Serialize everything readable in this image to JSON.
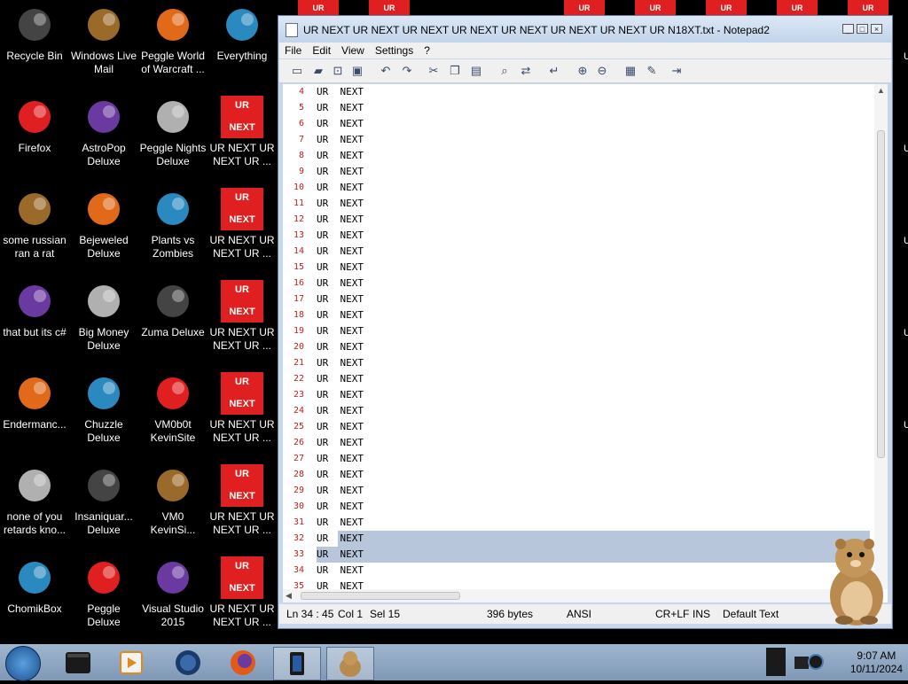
{
  "desktop": {
    "icons": [
      {
        "label": "Recycle Bin",
        "icon": "recycle-bin-icon"
      },
      {
        "label": "Windows Live Mail",
        "icon": "mail-icon"
      },
      {
        "label": "Peggle World of Warcraft ...",
        "icon": "peggle-icon"
      },
      {
        "label": "Everything",
        "icon": "search-app-icon"
      },
      {
        "label": "Firefox",
        "icon": "firefox-icon"
      },
      {
        "label": "AstroPop Deluxe",
        "icon": "astropop-icon"
      },
      {
        "label": "Peggle Nights Deluxe",
        "icon": "peggle-nights-icon"
      },
      {
        "label": "UR NEXT UR NEXT UR ...",
        "icon": "ur-next-icon"
      },
      {
        "label": "some russian ran a rat",
        "icon": "app-icon"
      },
      {
        "label": "Bejeweled Deluxe",
        "icon": "bejeweled-icon"
      },
      {
        "label": "Plants vs Zombies",
        "icon": "plants-icon"
      },
      {
        "label": "UR NEXT UR NEXT UR ...",
        "icon": "ur-next-icon"
      },
      {
        "label": "that but its c#",
        "icon": "app-icon"
      },
      {
        "label": "Big Money Deluxe",
        "icon": "big-money-icon"
      },
      {
        "label": "Zuma Deluxe",
        "icon": "zuma-icon"
      },
      {
        "label": "UR NEXT UR NEXT UR ...",
        "icon": "ur-next-icon"
      },
      {
        "label": "Endermanc...",
        "icon": "app-icon"
      },
      {
        "label": "Chuzzle Deluxe",
        "icon": "chuzzle-icon"
      },
      {
        "label": "VM0b0t KevinSite",
        "icon": "vm-icon"
      },
      {
        "label": "UR NEXT UR NEXT UR ...",
        "icon": "ur-next-icon"
      },
      {
        "label": "none of you retards kno...",
        "icon": "app-icon"
      },
      {
        "label": "Insaniquar... Deluxe",
        "icon": "insaniquarium-icon"
      },
      {
        "label": "VM0 KevinSi...",
        "icon": "vm-icon"
      },
      {
        "label": "UR NEXT UR NEXT UR ...",
        "icon": "ur-next-icon"
      },
      {
        "label": "ChomikBox",
        "icon": "chomikbox-icon"
      },
      {
        "label": "Peggle Deluxe",
        "icon": "peggle-icon"
      },
      {
        "label": "Visual Studio 2015",
        "icon": "visual-studio-icon"
      },
      {
        "label": "UR NEXT UR NEXT UR ...",
        "icon": "ur-next-icon"
      }
    ],
    "tile_top": "UR",
    "tile_bottom": "NEXT",
    "top_strip_label": "UR",
    "right_edge_char": "U"
  },
  "window": {
    "title": "UR NEXT UR NEXT UR NEXT UR NEXT UR NEXT UR NEXT UR NEXT UR N18XT.txt - Notepad2",
    "minimize": "_",
    "maximize": "□",
    "close": "×",
    "menu": [
      "File",
      "Edit",
      "View",
      "Settings",
      "?"
    ],
    "toolbar_icons": [
      "new-file-icon",
      "open-folder-icon",
      "browse-icon",
      "save-icon",
      "undo-icon",
      "redo-icon",
      "cut-icon",
      "copy-icon",
      "paste-icon",
      "find-icon",
      "replace-icon",
      "word-wrap-icon",
      "zoom-in-icon",
      "zoom-out-icon",
      "scheme-icon",
      "customize-icon",
      "exit-icon"
    ],
    "lines": [
      {
        "n": "4",
        "text": "UR  NEXT"
      },
      {
        "n": "5",
        "text": "UR  NEXT"
      },
      {
        "n": "6",
        "text": "UR  NEXT"
      },
      {
        "n": "7",
        "text": "UR  NEXT"
      },
      {
        "n": "8",
        "text": "UR  NEXT"
      },
      {
        "n": "9",
        "text": "UR  NEXT"
      },
      {
        "n": "10",
        "text": "UR  NEXT"
      },
      {
        "n": "11",
        "text": "UR  NEXT"
      },
      {
        "n": "12",
        "text": "UR  NEXT"
      },
      {
        "n": "13",
        "text": "UR  NEXT"
      },
      {
        "n": "14",
        "text": "UR  NEXT"
      },
      {
        "n": "15",
        "text": "UR  NEXT"
      },
      {
        "n": "16",
        "text": "UR  NEXT"
      },
      {
        "n": "17",
        "text": "UR  NEXT"
      },
      {
        "n": "18",
        "text": "UR  NEXT"
      },
      {
        "n": "19",
        "text": "UR  NEXT"
      },
      {
        "n": "20",
        "text": "UR  NEXT"
      },
      {
        "n": "21",
        "text": "UR  NEXT"
      },
      {
        "n": "22",
        "text": "UR  NEXT"
      },
      {
        "n": "23",
        "text": "UR  NEXT"
      },
      {
        "n": "24",
        "text": "UR  NEXT"
      },
      {
        "n": "25",
        "text": "UR  NEXT"
      },
      {
        "n": "26",
        "text": "UR  NEXT"
      },
      {
        "n": "27",
        "text": "UR  NEXT"
      },
      {
        "n": "28",
        "text": "UR  NEXT"
      },
      {
        "n": "29",
        "text": "UR  NEXT"
      },
      {
        "n": "30",
        "text": "UR  NEXT"
      },
      {
        "n": "31",
        "text": "UR  NEXT"
      },
      {
        "n": "32",
        "text": "UR  NEXT"
      },
      {
        "n": "33",
        "text": "UR  NEXT"
      },
      {
        "n": "34",
        "text": "UR  NEXT"
      },
      {
        "n": "35",
        "text": "UR  NEXT"
      }
    ],
    "status": {
      "position": "Ln 34 : 45",
      "col": "Col 1",
      "sel": "Sel 15",
      "size": "396 bytes",
      "encoding": "ANSI",
      "eol": "CR+LF",
      "mode": "INS",
      "scheme": "Default Text"
    }
  },
  "taskbar": {
    "items": [
      "terminal-icon",
      "media-player-icon",
      "globe-icon",
      "firefox-icon",
      "notepad-icon",
      "hamster-icon"
    ],
    "time": "9:07 AM",
    "date": "10/11/2024"
  },
  "colors": {
    "accent_red": "#e02020",
    "line_number": "#c02020",
    "selection": "#b8c6dc"
  }
}
